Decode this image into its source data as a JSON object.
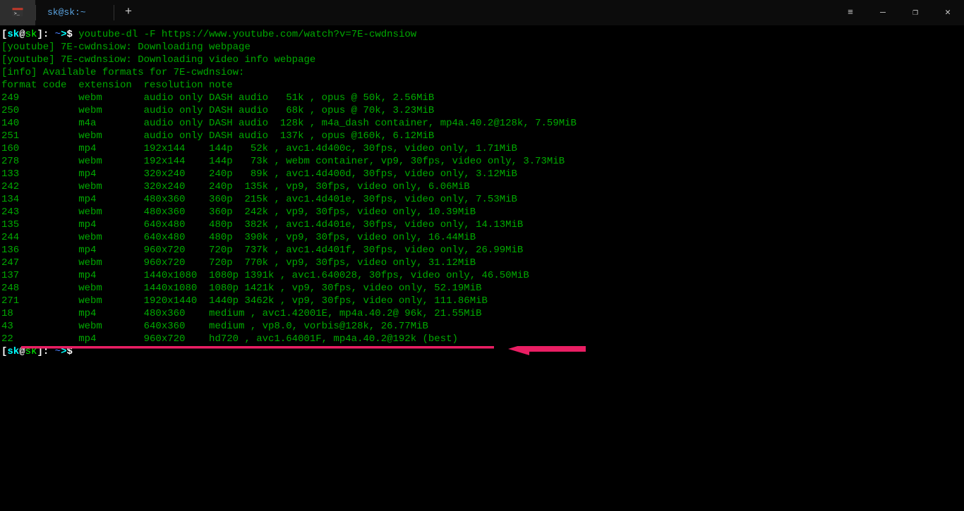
{
  "titlebar": {
    "tab_label": "sk@sk:~",
    "add_tab": "+",
    "menu": "≡",
    "minimize": "—",
    "maximize": "❐",
    "close": "✕"
  },
  "prompt": {
    "br_open": "[",
    "user": "sk",
    "at": "@",
    "host": "sk",
    "br_close": "]: ",
    "path": "~",
    "arrow": ">",
    "dollar": "$ "
  },
  "command": "youtube-dl -F https://www.youtube.com/watch?v=7E-cwdnsiow",
  "ytlines": [
    "[youtube] 7E-cwdnsiow: Downloading webpage",
    "[youtube] 7E-cwdnsiow: Downloading video info webpage",
    "[info] Available formats for 7E-cwdnsiow:"
  ],
  "header": "format code  extension  resolution note",
  "rows": [
    {
      "code": "249",
      "ext": "webm",
      "res": "audio only",
      "note": "DASH audio   51k , opus @ 50k, 2.56MiB"
    },
    {
      "code": "250",
      "ext": "webm",
      "res": "audio only",
      "note": "DASH audio   68k , opus @ 70k, 3.23MiB"
    },
    {
      "code": "140",
      "ext": "m4a",
      "res": "audio only",
      "note": "DASH audio  128k , m4a_dash container, mp4a.40.2@128k, 7.59MiB"
    },
    {
      "code": "251",
      "ext": "webm",
      "res": "audio only",
      "note": "DASH audio  137k , opus @160k, 6.12MiB"
    },
    {
      "code": "160",
      "ext": "mp4",
      "res": "192x144",
      "note": "144p   52k , avc1.4d400c, 30fps, video only, 1.71MiB"
    },
    {
      "code": "278",
      "ext": "webm",
      "res": "192x144",
      "note": "144p   73k , webm container, vp9, 30fps, video only, 3.73MiB"
    },
    {
      "code": "133",
      "ext": "mp4",
      "res": "320x240",
      "note": "240p   89k , avc1.4d400d, 30fps, video only, 3.12MiB"
    },
    {
      "code": "242",
      "ext": "webm",
      "res": "320x240",
      "note": "240p  135k , vp9, 30fps, video only, 6.06MiB"
    },
    {
      "code": "134",
      "ext": "mp4",
      "res": "480x360",
      "note": "360p  215k , avc1.4d401e, 30fps, video only, 7.53MiB"
    },
    {
      "code": "243",
      "ext": "webm",
      "res": "480x360",
      "note": "360p  242k , vp9, 30fps, video only, 10.39MiB"
    },
    {
      "code": "135",
      "ext": "mp4",
      "res": "640x480",
      "note": "480p  382k , avc1.4d401e, 30fps, video only, 14.13MiB"
    },
    {
      "code": "244",
      "ext": "webm",
      "res": "640x480",
      "note": "480p  390k , vp9, 30fps, video only, 16.44MiB"
    },
    {
      "code": "136",
      "ext": "mp4",
      "res": "960x720",
      "note": "720p  737k , avc1.4d401f, 30fps, video only, 26.99MiB"
    },
    {
      "code": "247",
      "ext": "webm",
      "res": "960x720",
      "note": "720p  770k , vp9, 30fps, video only, 31.12MiB"
    },
    {
      "code": "137",
      "ext": "mp4",
      "res": "1440x1080",
      "note": "1080p 1391k , avc1.640028, 30fps, video only, 46.50MiB"
    },
    {
      "code": "248",
      "ext": "webm",
      "res": "1440x1080",
      "note": "1080p 1421k , vp9, 30fps, video only, 52.19MiB"
    },
    {
      "code": "271",
      "ext": "webm",
      "res": "1920x1440",
      "note": "1440p 3462k , vp9, 30fps, video only, 111.86MiB"
    },
    {
      "code": "18",
      "ext": "mp4",
      "res": "480x360",
      "note": "medium , avc1.42001E, mp4a.40.2@ 96k, 21.55MiB"
    },
    {
      "code": "43",
      "ext": "webm",
      "res": "640x360",
      "note": "medium , vp8.0, vorbis@128k, 26.77MiB"
    },
    {
      "code": "22",
      "ext": "mp4",
      "res": "960x720",
      "note": "hd720 , avc1.64001F, mp4a.40.2@192k (best)"
    }
  ],
  "col_widths": {
    "code": 13,
    "ext": 11,
    "res": 11
  }
}
